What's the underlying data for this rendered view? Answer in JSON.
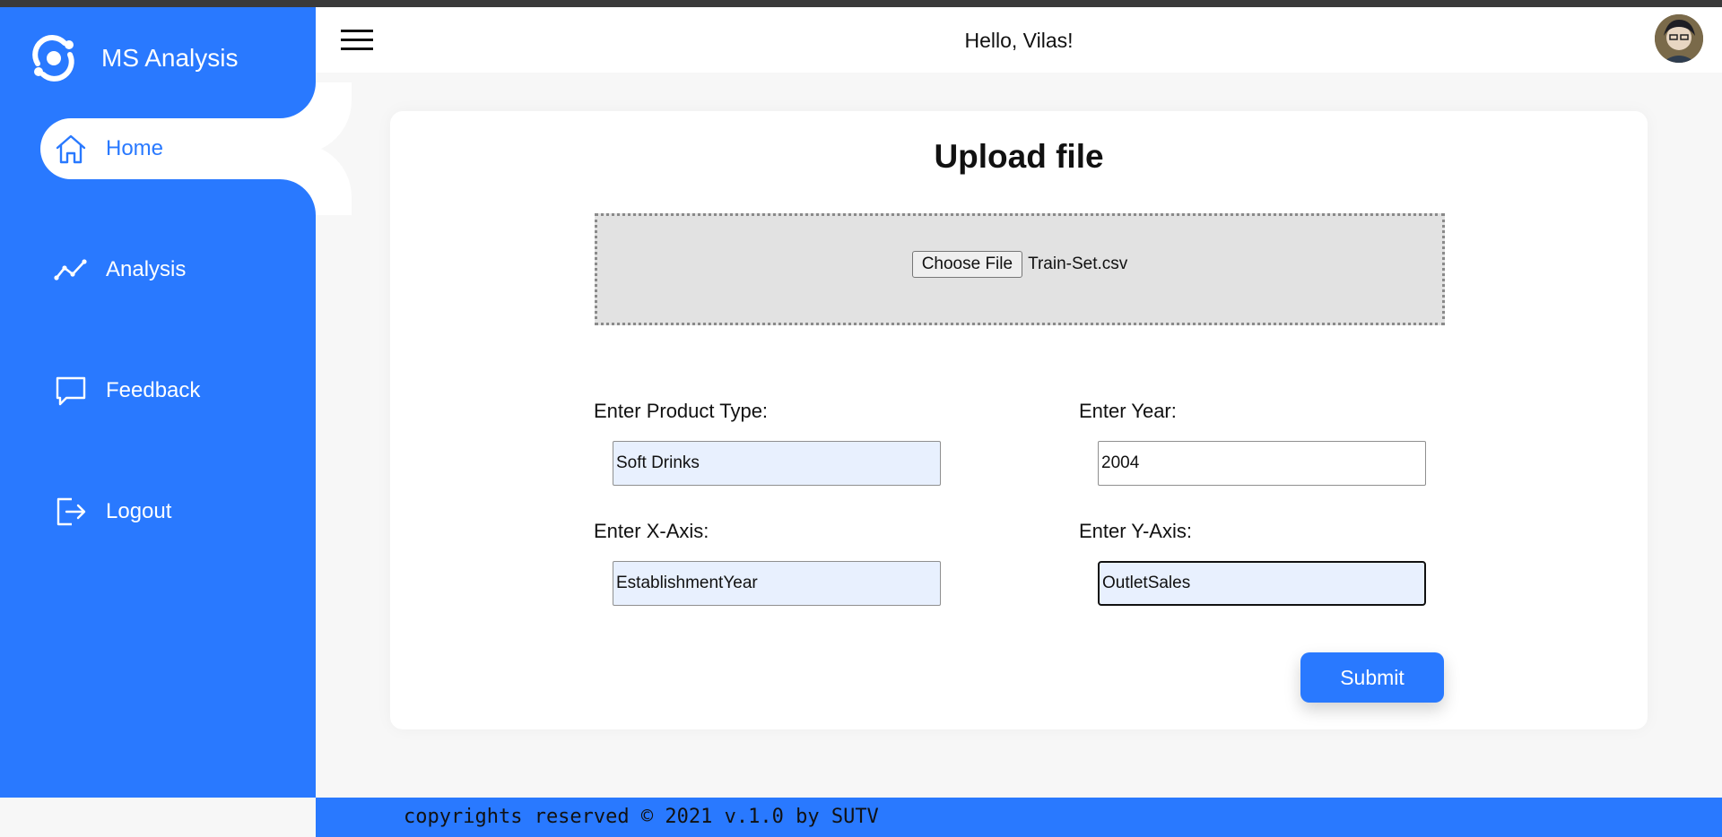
{
  "app": {
    "name": "MS Analysis",
    "brand_color": "#2979ff"
  },
  "sidebar": {
    "items": [
      {
        "label": "Home",
        "icon": "home-icon",
        "active": true
      },
      {
        "label": "Analysis",
        "icon": "trend-line-icon",
        "active": false
      },
      {
        "label": "Feedback",
        "icon": "chat-bubble-icon",
        "active": false
      },
      {
        "label": "Logout",
        "icon": "logout-icon",
        "active": false
      }
    ]
  },
  "header": {
    "greeting": "Hello, Vilas!",
    "menu_icon": "hamburger-icon",
    "avatar_icon": "user-avatar"
  },
  "upload": {
    "title": "Upload file",
    "choose_button": "Choose File",
    "file_name": "Train-Set.csv"
  },
  "form": {
    "product_type": {
      "label": "Enter Product Type:",
      "value": "Soft Drinks"
    },
    "year": {
      "label": "Enter Year:",
      "value": "2004"
    },
    "x_axis": {
      "label": "Enter X-Axis:",
      "value": "EstablishmentYear"
    },
    "y_axis": {
      "label": "Enter Y-Axis:",
      "value": "OutletSales"
    },
    "submit_label": "Submit"
  },
  "footer": {
    "text": "copyrights reserved © 2021 v.1.0 by SUTV"
  }
}
